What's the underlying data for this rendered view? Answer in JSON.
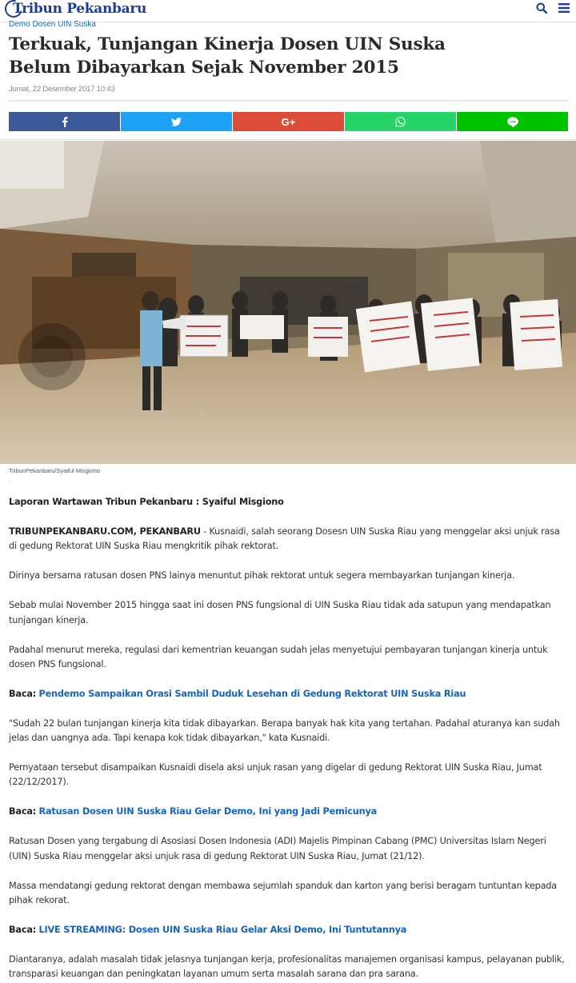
{
  "header": {
    "logo_text": "Tribun Pekanbaru",
    "icons": [
      "search-icon",
      "menu-icon"
    ]
  },
  "article": {
    "category": "Demo Dosen UIN Suska",
    "title": "Terkuak, Tunjangan Kinerja Dosen UIN Suska Belum Dibayarkan Sejak November 2015",
    "date": "Jumat, 22 Desember 2017 10:43",
    "share": [
      "facebook-icon",
      "twitter-icon",
      "google-plus-icon",
      "whatsapp-icon",
      "line-icon"
    ],
    "share_gplus_label": "G+",
    "caption": "TribunPekanbaru/Syaiful Misgiono",
    "caption_dot": ".",
    "byline": "Laporan Wartawan Tribun Pekanbaru : Syaiful Misgiono",
    "dateline": "TRIBUNPEKANBARU.COM, PEKANBARU",
    "p1": " - Kusnaidi, salah seorang Dosesn UIN Suska Riau yang menggelar aksi unjuk rasa di gedung Rektorat UIN Suska Riau mengkritik pihak rektorat.",
    "p2": "Dirinya bersama ratusan dosen PNS lainya menuntut pihak rektorat untuk segera membayarkan tunjangan kinerja.",
    "p3": "Sebab mulai November 2015 hingga saat ini dosen PNS fungsional di UIN Suska Riau tidak ada satupun yang mendapatkan tunjangan kinerja.",
    "p4": "Padahal menurut mereka, regulasi dari kementrian keuangan sudah jelas menyetujui pembayaran tunjangan kinerja untuk dosen PNS fungsional.",
    "baca_label": "Baca:",
    "baca1": "Pendemo Sampaikan Orasi Sambil Duduk Lesehan di Gedung Rektorat UIN Suska Riau",
    "p5": "\"Sudah 22 bulan tunjangan kinerja kita tidak dibayarkan. Berapa banyak hak kita yang tertahan. Padahal aturanya kan sudah jelas dan uangnya ada. Tapi kenapa kok tidak dibayarkan,\" kata Kusnaidi.",
    "p6": "Pernyataan tersebut disampaikan Kusnaidi disela aksi unjuk rasan yang digelar di gedung Rektorat UIN Suska Riau, Jumat (22/12/2017).",
    "baca2": "Ratusan Dosen UIN Suska Riau Gelar Demo, Ini yang Jadi Pemicunya",
    "p7": "Ratusan Dosen yang tergabung di Asosiasi Dosen Indonesia (ADI) Majelis Pimpinan Cabang (PMC) Universitas Islam Negeri (UIN) Suska Riau menggelar aksi unjuk rasa di gedung Rektorat UIN Suska Riau, Jumat (21/12).",
    "p8": "Massa mendatangi gedung rektorat dengan membawa sejumlah spanduk dan karton yang berisi beragam tuntuntan kepada pihak rekorat.",
    "baca3": "LIVE STREAMING: Dosen UIN Suska Riau Gelar Aksi Demo, Ini Tuntutannya",
    "p9": "Diantaranya, adalah masalah tidak jelasnya tunjangan kerja, profesionalitas manajemen organisasi kampus, pelayanan publik, transparasi keuangan dan peningkatan layanan umum serta masalah sarana dan pra sarana."
  },
  "colors": {
    "brand": "#1c3f94",
    "link": "#1565c0",
    "facebook": "#3b5998",
    "twitter": "#1da1f2",
    "google_plus": "#dd4b39",
    "whatsapp": "#25d366",
    "line": "#00c300"
  }
}
